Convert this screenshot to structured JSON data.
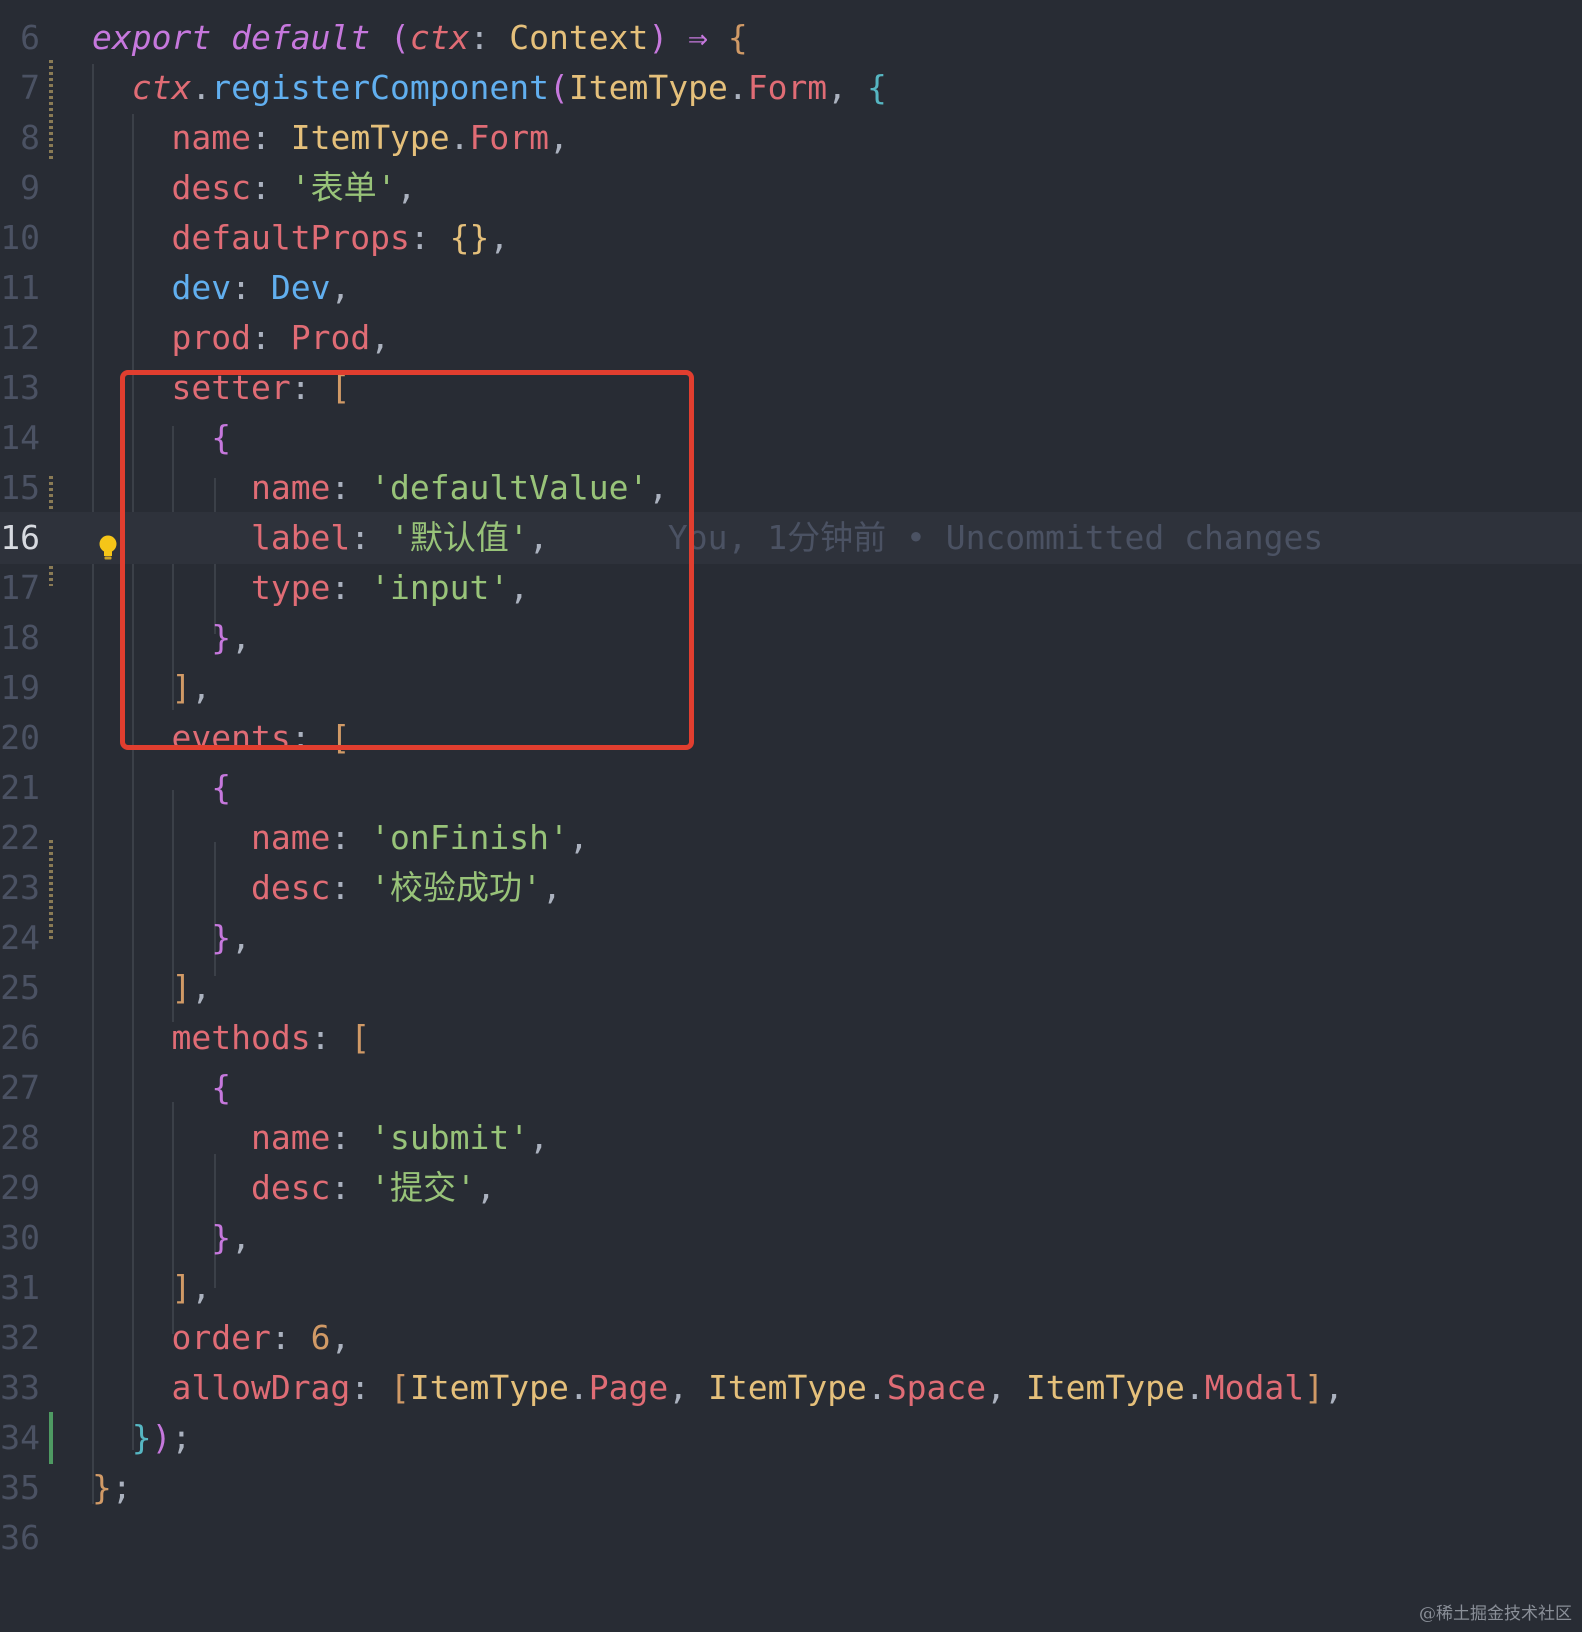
{
  "editor": {
    "current_line": 16,
    "blame": "You, 1分钟前 • Uncommitted changes",
    "lines": [
      {
        "n": "6",
        "t": [
          [
            "kw",
            "export"
          ],
          [
            "pun",
            " "
          ],
          [
            "kw",
            "default"
          ],
          [
            "pun",
            " "
          ],
          [
            "b1",
            "("
          ],
          [
            "ctx",
            "ctx"
          ],
          [
            "pun",
            ": "
          ],
          [
            "cls",
            "Context"
          ],
          [
            "b1",
            ")"
          ],
          [
            "pun",
            " "
          ],
          [
            "kw",
            "⇒"
          ],
          [
            "pun",
            " "
          ],
          [
            "b3",
            "{"
          ]
        ]
      },
      {
        "n": "7",
        "t": [
          [
            "pun",
            "  "
          ],
          [
            "ctx",
            "ctx"
          ],
          [
            "pun",
            "."
          ],
          [
            "fn",
            "registerComponent"
          ],
          [
            "b1",
            "("
          ],
          [
            "cls",
            "ItemType"
          ],
          [
            "pun",
            "."
          ],
          [
            "prop",
            "Form"
          ],
          [
            "pun",
            ", "
          ],
          [
            "b2",
            "{"
          ]
        ]
      },
      {
        "n": "8",
        "t": [
          [
            "pun",
            "    "
          ],
          [
            "prop",
            "name"
          ],
          [
            "pun",
            ": "
          ],
          [
            "cls",
            "ItemType"
          ],
          [
            "pun",
            "."
          ],
          [
            "prop",
            "Form"
          ],
          [
            "pun",
            ","
          ]
        ]
      },
      {
        "n": "9",
        "t": [
          [
            "pun",
            "    "
          ],
          [
            "prop",
            "desc"
          ],
          [
            "pun",
            ": "
          ],
          [
            "str",
            "'表单'"
          ],
          [
            "pun",
            ","
          ]
        ]
      },
      {
        "n": "10",
        "t": [
          [
            "pun",
            "    "
          ],
          [
            "prop",
            "defaultProps"
          ],
          [
            "pun",
            ": "
          ],
          [
            "b4",
            "{}"
          ],
          [
            "pun",
            ","
          ]
        ]
      },
      {
        "n": "11",
        "t": [
          [
            "pun",
            "    "
          ],
          [
            "fn",
            "dev"
          ],
          [
            "pun",
            ": "
          ],
          [
            "fn",
            "Dev"
          ],
          [
            "pun",
            ","
          ]
        ]
      },
      {
        "n": "12",
        "t": [
          [
            "pun",
            "    "
          ],
          [
            "prop",
            "prod"
          ],
          [
            "pun",
            ": "
          ],
          [
            "prop",
            "Prod"
          ],
          [
            "pun",
            ","
          ]
        ]
      },
      {
        "n": "13",
        "t": [
          [
            "pun",
            "    "
          ],
          [
            "prop",
            "setter"
          ],
          [
            "pun",
            ": "
          ],
          [
            "b3",
            "["
          ]
        ]
      },
      {
        "n": "14",
        "t": [
          [
            "pun",
            "      "
          ],
          [
            "b1",
            "{"
          ]
        ]
      },
      {
        "n": "15",
        "t": [
          [
            "pun",
            "        "
          ],
          [
            "prop",
            "name"
          ],
          [
            "pun",
            ": "
          ],
          [
            "str",
            "'defaultValue'"
          ],
          [
            "pun",
            ","
          ]
        ]
      },
      {
        "n": "16",
        "t": [
          [
            "pun",
            "        "
          ],
          [
            "prop",
            "label"
          ],
          [
            "pun",
            ": "
          ],
          [
            "str",
            "'默认值'"
          ],
          [
            "pun",
            ","
          ]
        ]
      },
      {
        "n": "17",
        "t": [
          [
            "pun",
            "        "
          ],
          [
            "prop",
            "type"
          ],
          [
            "pun",
            ": "
          ],
          [
            "str",
            "'input'"
          ],
          [
            "pun",
            ","
          ]
        ]
      },
      {
        "n": "18",
        "t": [
          [
            "pun",
            "      "
          ],
          [
            "b1",
            "}"
          ],
          [
            "pun",
            ","
          ]
        ]
      },
      {
        "n": "19",
        "t": [
          [
            "pun",
            "    "
          ],
          [
            "b3",
            "]"
          ],
          [
            "pun",
            ","
          ]
        ]
      },
      {
        "n": "20",
        "t": [
          [
            "pun",
            "    "
          ],
          [
            "prop",
            "events"
          ],
          [
            "pun",
            ": "
          ],
          [
            "b3",
            "["
          ]
        ]
      },
      {
        "n": "21",
        "t": [
          [
            "pun",
            "      "
          ],
          [
            "b1",
            "{"
          ]
        ]
      },
      {
        "n": "22",
        "t": [
          [
            "pun",
            "        "
          ],
          [
            "prop",
            "name"
          ],
          [
            "pun",
            ": "
          ],
          [
            "str",
            "'onFinish'"
          ],
          [
            "pun",
            ","
          ]
        ]
      },
      {
        "n": "23",
        "t": [
          [
            "pun",
            "        "
          ],
          [
            "prop",
            "desc"
          ],
          [
            "pun",
            ": "
          ],
          [
            "str",
            "'校验成功'"
          ],
          [
            "pun",
            ","
          ]
        ]
      },
      {
        "n": "24",
        "t": [
          [
            "pun",
            "      "
          ],
          [
            "b1",
            "}"
          ],
          [
            "pun",
            ","
          ]
        ]
      },
      {
        "n": "25",
        "t": [
          [
            "pun",
            "    "
          ],
          [
            "b3",
            "]"
          ],
          [
            "pun",
            ","
          ]
        ]
      },
      {
        "n": "26",
        "t": [
          [
            "pun",
            "    "
          ],
          [
            "prop",
            "methods"
          ],
          [
            "pun",
            ": "
          ],
          [
            "b3",
            "["
          ]
        ]
      },
      {
        "n": "27",
        "t": [
          [
            "pun",
            "      "
          ],
          [
            "b1",
            "{"
          ]
        ]
      },
      {
        "n": "28",
        "t": [
          [
            "pun",
            "        "
          ],
          [
            "prop",
            "name"
          ],
          [
            "pun",
            ": "
          ],
          [
            "str",
            "'submit'"
          ],
          [
            "pun",
            ","
          ]
        ]
      },
      {
        "n": "29",
        "t": [
          [
            "pun",
            "        "
          ],
          [
            "prop",
            "desc"
          ],
          [
            "pun",
            ": "
          ],
          [
            "str",
            "'提交'"
          ],
          [
            "pun",
            ","
          ]
        ]
      },
      {
        "n": "30",
        "t": [
          [
            "pun",
            "      "
          ],
          [
            "b1",
            "}"
          ],
          [
            "pun",
            ","
          ]
        ]
      },
      {
        "n": "31",
        "t": [
          [
            "pun",
            "    "
          ],
          [
            "b3",
            "]"
          ],
          [
            "pun",
            ","
          ]
        ]
      },
      {
        "n": "32",
        "t": [
          [
            "pun",
            "    "
          ],
          [
            "prop",
            "order"
          ],
          [
            "pun",
            ": "
          ],
          [
            "num",
            "6"
          ],
          [
            "pun",
            ","
          ]
        ]
      },
      {
        "n": "33",
        "t": [
          [
            "pun",
            "    "
          ],
          [
            "prop",
            "allowDrag"
          ],
          [
            "pun",
            ": "
          ],
          [
            "b3",
            "["
          ],
          [
            "cls",
            "ItemType"
          ],
          [
            "pun",
            "."
          ],
          [
            "prop",
            "Page"
          ],
          [
            "pun",
            ", "
          ],
          [
            "cls",
            "ItemType"
          ],
          [
            "pun",
            "."
          ],
          [
            "prop",
            "Space"
          ],
          [
            "pun",
            ", "
          ],
          [
            "cls",
            "ItemType"
          ],
          [
            "pun",
            "."
          ],
          [
            "prop",
            "Modal"
          ],
          [
            "b3",
            "]"
          ],
          [
            "pun",
            ","
          ]
        ]
      },
      {
        "n": "34",
        "t": [
          [
            "pun",
            "  "
          ],
          [
            "b2",
            "}"
          ],
          [
            "b1",
            ")"
          ],
          [
            "pun",
            ";"
          ]
        ]
      },
      {
        "n": "35",
        "t": [
          [
            "b3",
            "}"
          ],
          [
            "pun",
            ";"
          ]
        ]
      },
      {
        "n": "36",
        "t": []
      }
    ]
  },
  "watermark": "@稀土掘金技术社区",
  "colors": {
    "background": "#282c34",
    "current_line_bg": "#2e323b",
    "highlight_box": "#e13e2f",
    "keyword": "#c678dd",
    "string": "#98c379",
    "property": "#e06c75",
    "class": "#e5c07b",
    "function": "#61afef"
  },
  "icons": [
    "lightbulb-icon"
  ]
}
